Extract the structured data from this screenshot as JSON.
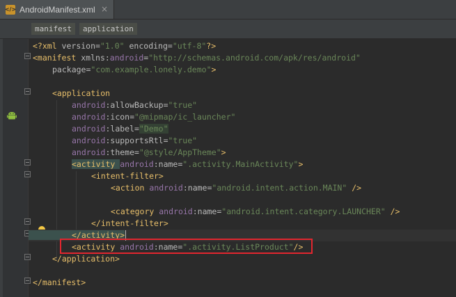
{
  "tab": {
    "filename": "AndroidManifest.xml",
    "icon": "xml-file-icon",
    "close": "×"
  },
  "breadcrumb": [
    "manifest",
    "application"
  ],
  "code": {
    "l1": {
      "p1": "<?xml ",
      "a1": "version",
      "eq1": "=",
      "v1": "\"1.0\"",
      "a2": " encoding",
      "eq2": "=",
      "v2": "\"utf-8\"",
      "p2": "?>"
    },
    "l2": {
      "p1": "<manifest ",
      "a1": "xmlns:",
      "ns": "android",
      "eq": "=",
      "v": "\"http://schemas.android.com/apk/res/android\""
    },
    "l3": {
      "a": "package",
      "eq": "=",
      "v": "\"com.example.lonely.demo\"",
      "p": ">"
    },
    "l5": {
      "p": "<application"
    },
    "l6": {
      "ns": "android",
      "a": ":allowBackup",
      "eq": "=",
      "v": "\"true\""
    },
    "l7": {
      "ns": "android",
      "a": ":icon",
      "eq": "=",
      "v": "\"@mipmap/ic_launcher\""
    },
    "l8": {
      "ns": "android",
      "a": ":label",
      "eq": "=",
      "v": "\"Demo\""
    },
    "l9": {
      "ns": "android",
      "a": ":supportsRtl",
      "eq": "=",
      "v": "\"true\""
    },
    "l10": {
      "ns": "android",
      "a": ":theme",
      "eq": "=",
      "v": "\"@style/AppTheme\"",
      "p": ">"
    },
    "l11": {
      "p1": "<activity ",
      "ns": "android",
      "a": ":name",
      "eq": "=",
      "v": "\".activity.MainActivity\"",
      "p2": ">"
    },
    "l12": {
      "p": "<intent-filter>"
    },
    "l13": {
      "p1": "<action ",
      "ns": "android",
      "a": ":name",
      "eq": "=",
      "v": "\"android.intent.action.MAIN\"",
      "p2": " />"
    },
    "l15": {
      "p1": "<category ",
      "ns": "android",
      "a": ":name",
      "eq": "=",
      "v": "\"android.intent.category.LAUNCHER\"",
      "p2": " />"
    },
    "l16": {
      "p": "</intent-filter>"
    },
    "l17": {
      "p": "</activity>"
    },
    "l18": {
      "p1": "<activity ",
      "ns": "android",
      "a": ":name",
      "eq": "=",
      "v": "\".activity.ListProduct\"",
      "p2": "/>"
    },
    "l19": {
      "p": "</application>"
    },
    "l21": {
      "p": "</manifest>"
    }
  },
  "colors": {
    "tag": "#e8bf6a",
    "namespace": "#9876aa",
    "value": "#6a8759",
    "highlight_box": "#e3262f"
  }
}
